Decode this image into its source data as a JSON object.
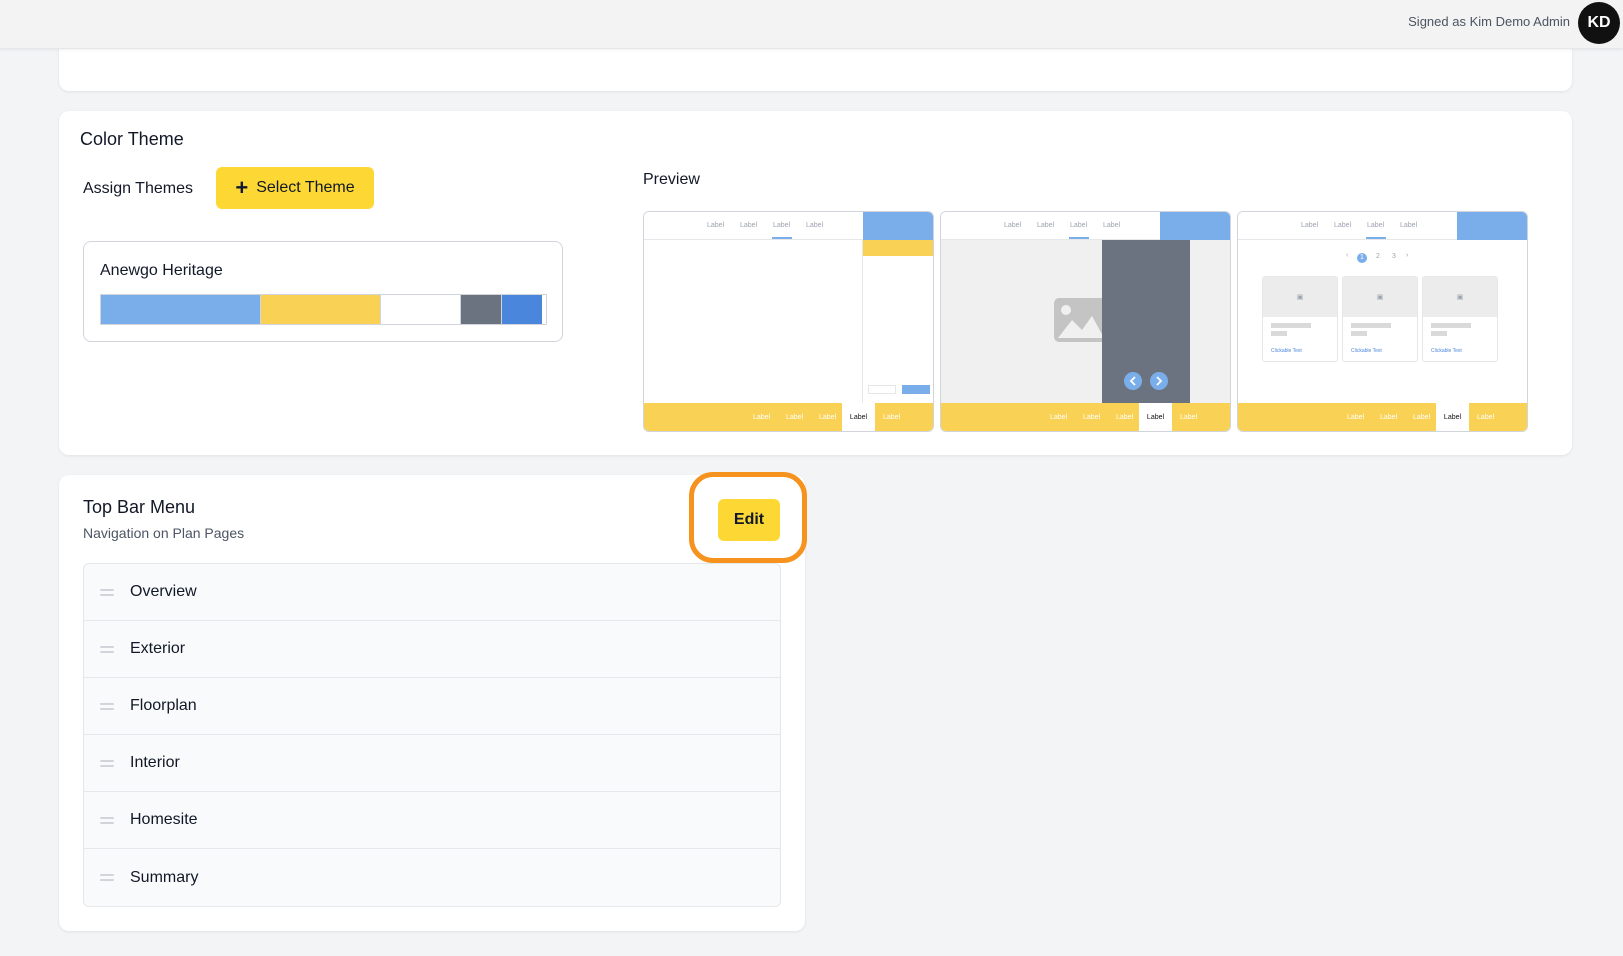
{
  "header": {
    "signed_in_text": "Signed as Kim Demo Admin",
    "avatar_initials": "KD"
  },
  "color_theme": {
    "title": "Color Theme",
    "assign_label": "Assign Themes",
    "select_button": "Select Theme",
    "select_icon": "plus-icon",
    "theme": {
      "name": "Anewgo Heritage",
      "swatches": [
        {
          "color": "#7aaeea",
          "share": 0.36
        },
        {
          "color": "#f9d155",
          "share": 0.27
        },
        {
          "color": "#ffffff",
          "share": 0.18
        },
        {
          "color": "#6b7280",
          "share": 0.09
        },
        {
          "color": "#4a86db",
          "share": 0.09
        }
      ]
    },
    "preview_label": "Preview",
    "preview": {
      "nav_labels": [
        "Label",
        "Label",
        "Label",
        "Label"
      ],
      "footer_labels": [
        "Label",
        "Label",
        "Label",
        "Label",
        "Label"
      ],
      "pages": [
        "1",
        "2",
        "3"
      ],
      "card_link": "Clickable Text"
    }
  },
  "top_bar_menu": {
    "title": "Top Bar Menu",
    "subtitle": "Navigation on Plan Pages",
    "edit_button": "Edit",
    "items": [
      {
        "label": "Overview"
      },
      {
        "label": "Exterior"
      },
      {
        "label": "Floorplan"
      },
      {
        "label": "Interior"
      },
      {
        "label": "Homesite"
      },
      {
        "label": "Summary"
      }
    ]
  },
  "colors": {
    "accent_yellow": "#fdd835",
    "highlight_orange": "#f6921e",
    "theme_blue": "#7aaeea",
    "theme_yellow": "#f9d155"
  }
}
